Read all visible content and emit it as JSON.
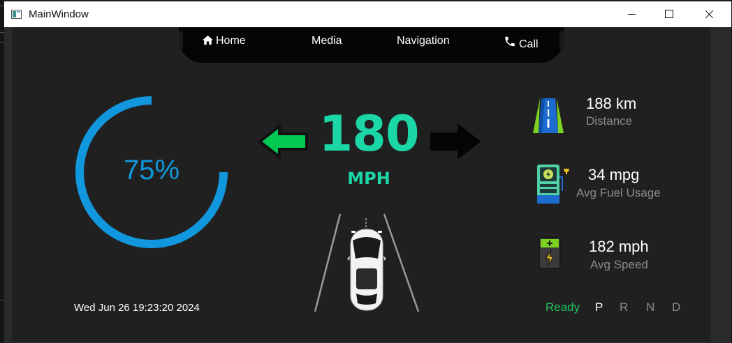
{
  "window": {
    "title": "MainWindow"
  },
  "nav": {
    "items": [
      {
        "label": "Home",
        "icon": "home-icon"
      },
      {
        "label": "Media"
      },
      {
        "label": "Navigation"
      },
      {
        "label": "Call",
        "icon": "phone-icon"
      }
    ]
  },
  "battery": {
    "percent_label": "75%",
    "level": 0.75,
    "color": "#1197dd"
  },
  "speed": {
    "value": "180",
    "unit": "MPH",
    "color": "#1bd6a6"
  },
  "turn_signals": {
    "left_active": true,
    "right_active": false,
    "active_color": "#00c853"
  },
  "stats": [
    {
      "value": "188 km",
      "label": "Distance",
      "icon": "road-icon"
    },
    {
      "value": "34 mpg",
      "label": "Avg Fuel Usage",
      "icon": "fuel-pump-icon"
    },
    {
      "value": "182 mph",
      "label": "Avg Speed",
      "icon": "battery-icon"
    }
  ],
  "status": {
    "datetime": "Wed Jun 26 19:23:20 2024",
    "ready_label": "Ready",
    "ready_color": "#22c55e",
    "gears": [
      "P",
      "R",
      "N",
      "D"
    ],
    "active_gear": "P"
  }
}
